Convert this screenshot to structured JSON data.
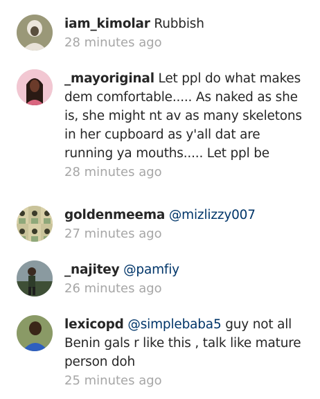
{
  "comments": [
    {
      "username": "iam_kimolar",
      "mention": "",
      "text": " Rubbish",
      "time": "28 minutes ago",
      "avatar_icon": "user-photo-icon",
      "avatar_colors": [
        "#8a8a6a",
        "#e8e2d8",
        "#5a4f3e"
      ]
    },
    {
      "username": "_mayoriginal",
      "mention": "",
      "text": " Let ppl do what makes dem comfortable..... As naked as she is, she might nt av as many skeletons in her cupboard as y'all dat are running ya mouths..... Let ppl be",
      "time": "28 minutes ago",
      "avatar_icon": "user-photo-icon",
      "avatar_colors": [
        "#efb9c6",
        "#2a1a14",
        "#d9657f"
      ]
    },
    {
      "username": "goldenmeema",
      "mention": " @mizlizzy007",
      "text": "",
      "time": "27 minutes ago",
      "avatar_icon": "user-photo-collage-icon",
      "avatar_colors": [
        "#d8d0a8",
        "#3b3b2a",
        "#8fa87a"
      ]
    },
    {
      "username": "_najitey",
      "mention": " @pamfiy",
      "text": "",
      "time": "26 minutes ago",
      "avatar_icon": "user-photo-icon",
      "avatar_colors": [
        "#6f7f86",
        "#2e3c2a",
        "#b5a98a"
      ]
    },
    {
      "username": "lexicopd",
      "mention": " @simplebaba5",
      "text": "  guy not all Benin gals r like this , talk like mature person doh",
      "time": "25 minutes ago",
      "avatar_icon": "user-photo-icon",
      "avatar_colors": [
        "#7a8a5a",
        "#3a2618",
        "#2e5fbf"
      ]
    }
  ]
}
